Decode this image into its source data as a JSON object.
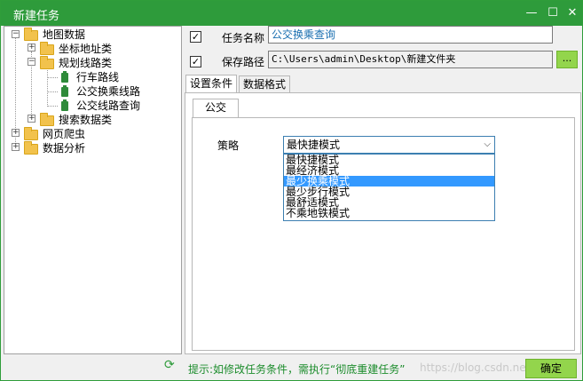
{
  "window": {
    "title": "新建任务",
    "min": "—",
    "max": "☐",
    "close": "✕"
  },
  "tree": {
    "root": "地图数据",
    "coord": "坐标地址类",
    "route": "规划线路类",
    "drive": "行车路线",
    "transfer": "公交换乘线路",
    "busline": "公交线路查询",
    "search": "搜索数据类",
    "crawler": "网页爬虫",
    "analysis": "数据分析"
  },
  "form": {
    "task_name_label": "任务名称",
    "task_name_value": "公交换乘查询",
    "task_name_checked": "✓",
    "save_path_label": "保存路径",
    "save_path_value": "C:\\Users\\admin\\Desktop\\新建文件夹",
    "save_path_checked": "✓",
    "browse_label": "..."
  },
  "tabs": {
    "settings": "设置条件",
    "format": "数据格式",
    "sub_bus": "公交"
  },
  "strategy": {
    "label": "策略",
    "selected": "最快捷模式",
    "options": [
      "最快捷模式",
      "最经济模式",
      "最少换乘模式",
      "最少步行模式",
      "最舒适模式",
      "不乘地铁模式"
    ],
    "highlighted_index": 2
  },
  "footer": {
    "hint": "提示:如修改任务条件，需执行“彻底重建任务”",
    "ok": "确定",
    "watermark": "https://blog.csdn.net/"
  }
}
